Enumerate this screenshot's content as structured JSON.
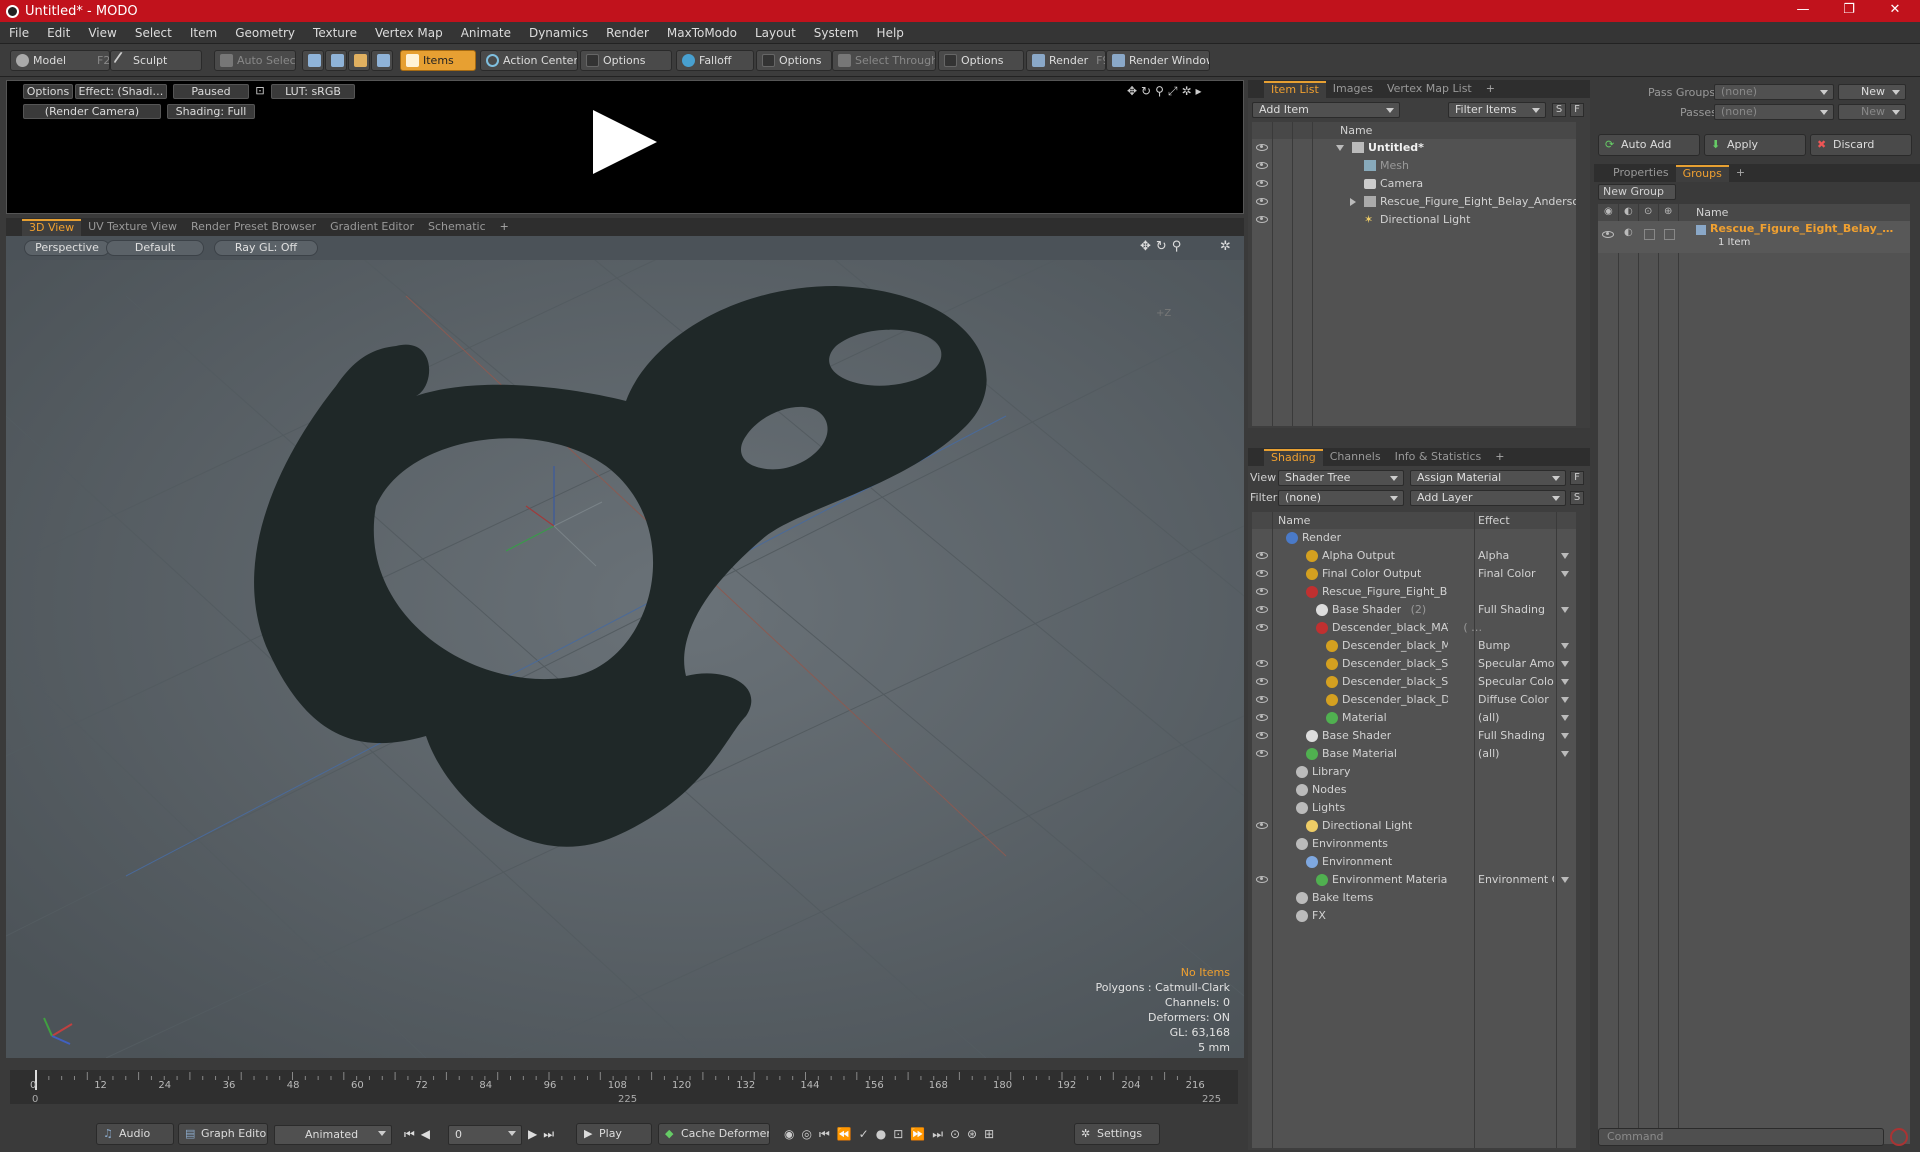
{
  "window": {
    "title": "Untitled* - MODO",
    "minimize": "—",
    "restore": "❐",
    "close": "✕"
  },
  "menu": [
    "File",
    "Edit",
    "View",
    "Select",
    "Item",
    "Geometry",
    "Texture",
    "Vertex Map",
    "Animate",
    "Dynamics",
    "Render",
    "MaxToModo",
    "Layout",
    "System",
    "Help"
  ],
  "toolbar": {
    "model": "Model",
    "model_key": "F2",
    "sculpt": "Sculpt",
    "auto_select": "Auto Select",
    "items": "Items",
    "action_center": "Action Center",
    "options1": "Options",
    "falloff": "Falloff",
    "options2": "Options",
    "select_through": "Select Through",
    "options3": "Options",
    "render": "Render",
    "render_key": "F9",
    "render_window": "Render Window"
  },
  "preview": {
    "options": "Options",
    "effect": "Effect: (Shadi…",
    "paused": "Paused",
    "lut": "LUT: sRGB",
    "camera": "(Render Camera)",
    "shading": "Shading: Full"
  },
  "viewtabs": [
    "3D View",
    "UV Texture View",
    "Render Preset Browser",
    "Gradient Editor",
    "Schematic",
    "+"
  ],
  "viewport": {
    "perspective": "Perspective",
    "default": "Default",
    "raygl": "Ray GL: Off",
    "axis_label": "+Z",
    "hud": {
      "no_items": "No Items",
      "polygons": "Polygons : Catmull-Clark",
      "channels": "Channels: 0",
      "deformers": "Deformers: ON",
      "gl": "GL: 63,168",
      "unit": "5 mm"
    }
  },
  "timeline": {
    "ticks": [
      "0",
      "12",
      "24",
      "36",
      "48",
      "60",
      "72",
      "84",
      "96",
      "108",
      "120",
      "132",
      "144",
      "156",
      "168",
      "180",
      "192",
      "204",
      "216"
    ],
    "start": "0",
    "mid": "225",
    "end": "225"
  },
  "bottom": {
    "audio": "Audio",
    "graph_editor": "Graph Editor",
    "animated": "Animated",
    "frame": "0",
    "play": "Play",
    "cache_deformers": "Cache Deformers",
    "settings": "Settings"
  },
  "itemlist": {
    "tabs": [
      "Item List",
      "Images",
      "Vertex Map List",
      "+"
    ],
    "add_item": "Add Item",
    "filter_items": "Filter Items",
    "s": "S",
    "f": "F",
    "col_name": "Name",
    "rows": [
      {
        "label": "Untitled*",
        "bold": true,
        "indent": 0
      },
      {
        "label": "Mesh",
        "dim": true,
        "indent": 1
      },
      {
        "label": "Camera",
        "indent": 1
      },
      {
        "label": "Rescue_Figure_Eight_Belay_Anderso …",
        "indent": 1
      },
      {
        "label": "Directional Light",
        "indent": 1
      }
    ]
  },
  "shading": {
    "tabs": [
      "Shading",
      "Channels",
      "Info & Statistics",
      "+"
    ],
    "view_label": "View",
    "view_value": "Shader Tree",
    "assign_material": "Assign Material",
    "f": "F",
    "filter_label": "Filter",
    "filter_value": "(none)",
    "add_layer": "Add Layer",
    "s": "S",
    "col_name": "Name",
    "col_effect": "Effect",
    "rows": [
      {
        "name": "Render",
        "effect": "",
        "indent": 0
      },
      {
        "name": "Alpha Output",
        "effect": "Alpha",
        "indent": 2
      },
      {
        "name": "Final Color Output",
        "effect": "Final Color",
        "indent": 2
      },
      {
        "name": "Rescue_Figure_Eight_Bela …",
        "effect": "",
        "indent": 2
      },
      {
        "name": "Base Shader",
        "dim": "(2)",
        "effect": "Full Shading",
        "indent": 3
      },
      {
        "name": "Descender_black_MAT",
        "dim": "( …",
        "effect": "",
        "indent": 3
      },
      {
        "name": "Descender_black_MA …",
        "effect": "Bump",
        "indent": 4
      },
      {
        "name": "Descender_black_Spe…",
        "effect": "Specular Amount",
        "indent": 4
      },
      {
        "name": "Descender_black_Spe…",
        "effect": "Specular Color",
        "indent": 4
      },
      {
        "name": "Descender_black_Diff…",
        "effect": "Diffuse Color",
        "indent": 4
      },
      {
        "name": "Material",
        "effect": "(all)",
        "indent": 4
      },
      {
        "name": "Base Shader",
        "effect": "Full Shading",
        "indent": 2
      },
      {
        "name": "Base Material",
        "effect": "(all)",
        "indent": 2
      },
      {
        "name": "Library",
        "effect": "",
        "indent": 1
      },
      {
        "name": "Nodes",
        "effect": "",
        "indent": 1
      },
      {
        "name": "Lights",
        "effect": "",
        "indent": 1
      },
      {
        "name": "Directional Light",
        "effect": "",
        "indent": 2
      },
      {
        "name": "Environments",
        "effect": "",
        "indent": 1
      },
      {
        "name": "Environment",
        "effect": "",
        "indent": 2
      },
      {
        "name": "Environment Material",
        "effect": "Environment Color",
        "indent": 3
      },
      {
        "name": "Bake Items",
        "effect": "",
        "indent": 1
      },
      {
        "name": "FX",
        "effect": "",
        "indent": 1
      }
    ]
  },
  "groups": {
    "pass_groups": "Pass Groups",
    "pass_groups_value": "(none)",
    "new": "New",
    "passes": "Passes",
    "passes_value": "(none)",
    "new2": "New",
    "auto_add": "Auto Add",
    "apply": "Apply",
    "discard": "Discard",
    "tabs": [
      "Properties",
      "Groups",
      "+"
    ],
    "new_group": "New Group",
    "col_name": "Name",
    "group_name": "Rescue_Figure_Eight_Belay_…",
    "group_count": "1 Item"
  },
  "command": {
    "placeholder": "Command"
  }
}
